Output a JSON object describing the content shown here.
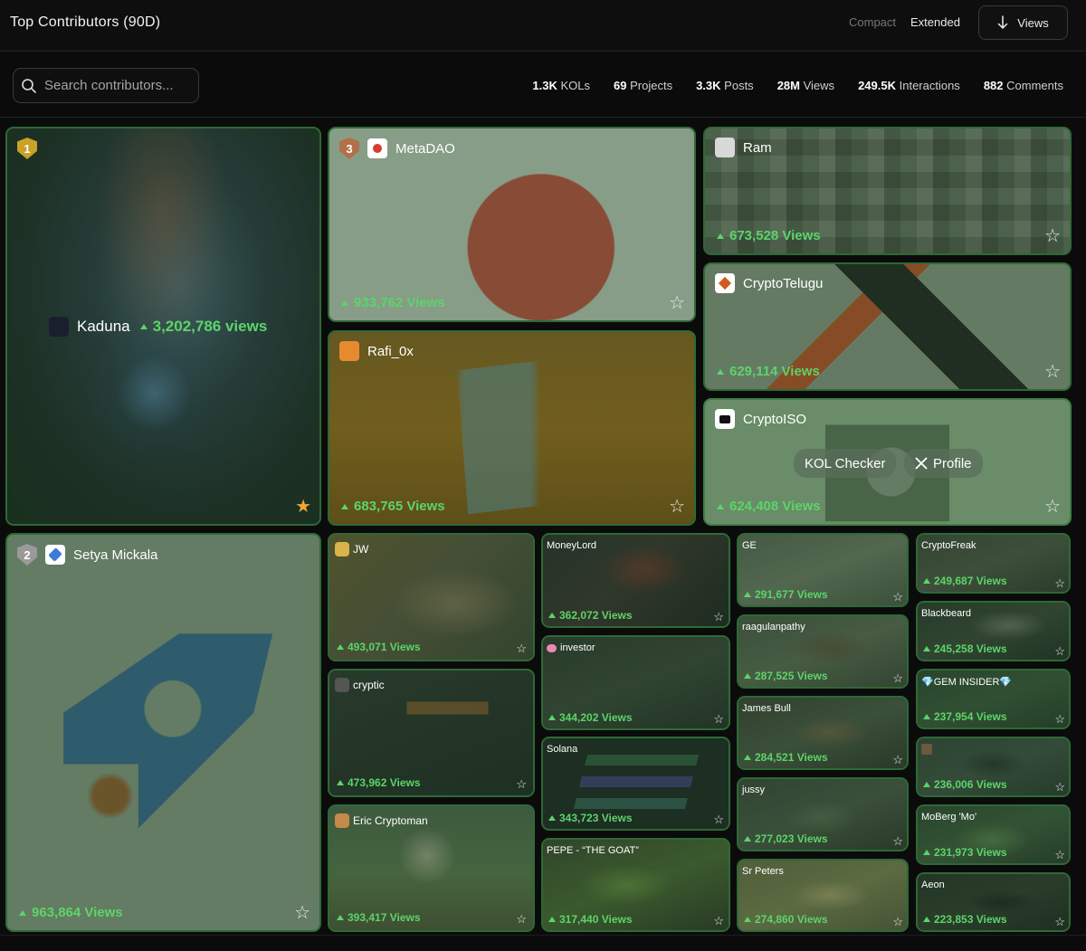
{
  "header": {
    "title": "Top Contributors (90D)",
    "mode_compact": "Compact",
    "mode_extended": "Extended",
    "views_button": "Views"
  },
  "toolbar": {
    "search_placeholder": "Search contributors...",
    "stats": [
      {
        "value": "1.3K",
        "label": "KOLs"
      },
      {
        "value": "69",
        "label": "Projects"
      },
      {
        "value": "3.3K",
        "label": "Posts"
      },
      {
        "value": "28M",
        "label": "Views"
      },
      {
        "value": "249.5K",
        "label": "Interactions"
      },
      {
        "value": "882",
        "label": "Comments"
      }
    ]
  },
  "tiles": {
    "kaduna": {
      "rank": "1",
      "name": "Kaduna",
      "views": "3,202,786 views"
    },
    "metadao": {
      "rank": "3",
      "name": "MetaDAO",
      "views": "933,762 Views"
    },
    "ram": {
      "name": "Ram",
      "views": "673,528 Views"
    },
    "rafi": {
      "name": "Rafi_0x",
      "views": "683,765 Views"
    },
    "cryptotelugu": {
      "name": "CryptoTelugu",
      "views": "629,114 Views"
    },
    "cryptoiso": {
      "name": "CryptoISO",
      "views": "624,408 Views",
      "kol_checker": "KOL Checker",
      "profile": "Profile"
    },
    "setya": {
      "rank": "2",
      "name": "Setya Mickala",
      "views": "963,864 Views"
    },
    "jw": {
      "name": "JW",
      "views": "493,071 Views"
    },
    "cryptic": {
      "name": "cryptic",
      "views": "473,962 Views"
    },
    "eric": {
      "name": "Eric Cryptoman",
      "views": "393,417 Views"
    },
    "moneylord": {
      "name": "MoneyLord",
      "views": "362,072 Views"
    },
    "investor": {
      "name": "investor",
      "views": "344,202 Views"
    },
    "solana": {
      "name": "Solana",
      "views": "343,723 Views"
    },
    "pepe": {
      "name": "PEPE - “THE GOAT”",
      "views": "317,440 Views"
    },
    "ge": {
      "name": "GE",
      "views": "291,677 Views"
    },
    "raagulan": {
      "name": "raagulanpathy",
      "views": "287,525 Views"
    },
    "jamesbull": {
      "name": "James Bull",
      "views": "284,521 Views"
    },
    "jussy": {
      "name": "jussy",
      "views": "277,023 Views"
    },
    "srpeters": {
      "name": "Sr Peters",
      "views": "274,860 Views"
    },
    "cryptofreak": {
      "name": "CryptoFreak",
      "views": "249,687 Views"
    },
    "blackbeard": {
      "name": "Blackbeard",
      "views": "245,258 Views"
    },
    "gem": {
      "name": "💎GEM INSIDER💎",
      "views": "237,954 Views"
    },
    "eagle": {
      "views": "236,006 Views"
    },
    "moberg": {
      "name": "MoBerg 'Mo'",
      "views": "231,973 Views"
    },
    "aeon": {
      "name": "Aeon",
      "views": "223,853 Views"
    }
  },
  "colors": {
    "accent_green": "#5cd46a",
    "tile_border": "#2d6a35",
    "gold_badge": "#c9a227",
    "silver_badge": "#9a9a9a",
    "bronze_badge": "#b0704a",
    "favorite_star": "#f2a33a"
  },
  "icons": {
    "search": "search-icon",
    "sort": "arrow-down-icon",
    "star": "star-icon",
    "x": "x-logo-icon"
  }
}
